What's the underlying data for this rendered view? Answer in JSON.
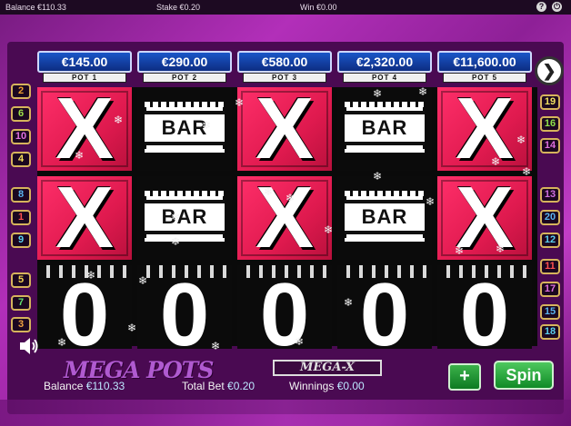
{
  "topbar": {
    "balance": "Balance  €110.33",
    "stake": "Stake  €0.20",
    "win": "Win  €0.00",
    "help_icon": "?",
    "close_icon": "⏻"
  },
  "pots": [
    {
      "value": "€145.00",
      "label": "POT 1"
    },
    {
      "value": "€290.00",
      "label": "POT 2"
    },
    {
      "value": "€580.00",
      "label": "POT 3"
    },
    {
      "value": "€2,320.00",
      "label": "POT 4"
    },
    {
      "value": "€11,600.00",
      "label": "POT 5"
    }
  ],
  "reels": {
    "row1": [
      "X",
      "BAR",
      "X",
      "BAR",
      "X"
    ],
    "row2": [
      "X",
      "BAR",
      "X",
      "BAR",
      "X"
    ],
    "row3": [
      "0",
      "0",
      "0",
      "0",
      "0"
    ]
  },
  "paylines": {
    "left": [
      {
        "n": "2",
        "color": "#f0a030"
      },
      {
        "n": "6",
        "color": "#9ee04a"
      },
      {
        "n": "10",
        "color": "#e070e0"
      },
      {
        "n": "4",
        "color": "#f6e05a"
      },
      {
        "n": "8",
        "color": "#5ab4f0"
      },
      {
        "n": "1",
        "color": "#ff5050"
      },
      {
        "n": "9",
        "color": "#5ad0f0"
      },
      {
        "n": "5",
        "color": "#f0d050"
      },
      {
        "n": "7",
        "color": "#60e070"
      },
      {
        "n": "3",
        "color": "#f0a040"
      }
    ],
    "right": [
      {
        "n": "19",
        "color": "#f0e060"
      },
      {
        "n": "16",
        "color": "#8ee04a"
      },
      {
        "n": "14",
        "color": "#e070e0"
      },
      {
        "n": "13",
        "color": "#d070e0"
      },
      {
        "n": "20",
        "color": "#5ab4f0"
      },
      {
        "n": "12",
        "color": "#5ad0f0"
      },
      {
        "n": "11",
        "color": "#ff5050"
      },
      {
        "n": "17",
        "color": "#e070e0"
      },
      {
        "n": "15",
        "color": "#5ab4f0"
      },
      {
        "n": "18",
        "color": "#5ad0f0"
      }
    ]
  },
  "logo": {
    "main": "MEGA POTS",
    "sub": "MEGA-X"
  },
  "footer": {
    "balance_label": "Balance",
    "balance_value": "€110.33",
    "bet_label": "Total Bet",
    "bet_value": "€0.20",
    "win_label": "Winnings",
    "win_value": "€0.00"
  },
  "controls": {
    "plus": "+",
    "spin": "Spin",
    "arrow_icon": "play-arrow-icon",
    "speaker_icon": "speaker-icon"
  }
}
